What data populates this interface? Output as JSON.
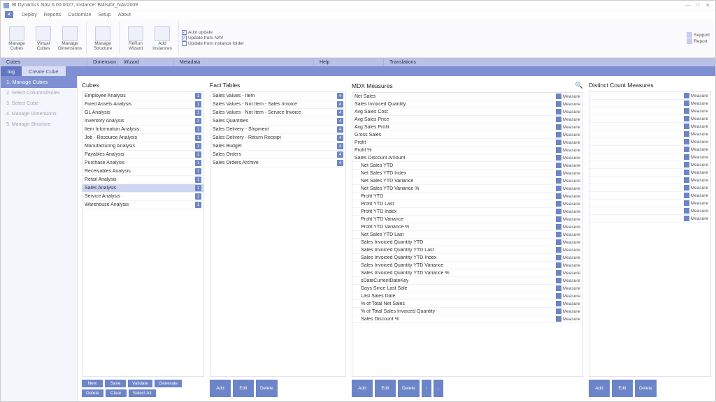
{
  "window": {
    "title": "BI Dynamics NAV 6.00.0027, Instance: BI4NAV_NAV2009"
  },
  "menu": {
    "items": [
      "Deploy",
      "Reports",
      "Customize",
      "Setup",
      "About"
    ]
  },
  "ribbon": {
    "groups": [
      {
        "label": "Cubes",
        "buttons": [
          {
            "key": "manage-cubes",
            "label": "Manage Cubes"
          },
          {
            "key": "virtual-cubes",
            "label": "Virtual Cubes"
          },
          {
            "key": "manage-dimensions",
            "label": "Manage Dimensions"
          }
        ]
      },
      {
        "label": "Dimension",
        "buttons": [
          {
            "key": "manage-structure",
            "label": "Manage Structure"
          }
        ]
      },
      {
        "label": "Wizard",
        "buttons": [
          {
            "key": "rerun-wizard",
            "label": "ReRun Wizard"
          },
          {
            "key": "add-instances",
            "label": "Add Instances"
          }
        ]
      }
    ],
    "checks": [
      {
        "key": "auto-update",
        "label": "Auto update",
        "checked": true
      },
      {
        "key": "update-from-nav",
        "label": "Update from NAV",
        "checked": true
      },
      {
        "key": "update-from-instance",
        "label": "Update from instance folder",
        "checked": false
      }
    ],
    "group_footer_labels": [
      "Cubes",
      "Dimension",
      "Wizard",
      "",
      "Metadata",
      "Help",
      "Translations"
    ],
    "right": [
      {
        "label": "Support"
      },
      {
        "label": "Report"
      }
    ]
  },
  "crumbs": {
    "log": "log",
    "create": "Create Cube"
  },
  "sidebar": {
    "items": [
      {
        "label": "1. Manage Cubes",
        "active": true
      },
      {
        "label": "2. Select Columns/Roles",
        "active": false
      },
      {
        "label": "3. Select Cube",
        "active": false
      },
      {
        "label": "4. Manage Dimensions",
        "active": false
      },
      {
        "label": "5. Manage Structure",
        "active": false
      }
    ]
  },
  "panels": {
    "cubes": {
      "title": "Cubes",
      "items": [
        {
          "label": "Employee Analysis",
          "badge": "1"
        },
        {
          "label": "Fixed Assets Analysis",
          "badge": "1"
        },
        {
          "label": "GL Analysis",
          "badge": "1"
        },
        {
          "label": "Inventory Analysis",
          "badge": "2"
        },
        {
          "label": "Item Information Analysis",
          "badge": "1"
        },
        {
          "label": "Job - Resource Analysis",
          "badge": "1"
        },
        {
          "label": "Manufacturing Analysis",
          "badge": "1"
        },
        {
          "label": "Payables Analysis",
          "badge": "1"
        },
        {
          "label": "Purchase Analysis",
          "badge": "1"
        },
        {
          "label": "Receivables Analysis",
          "badge": "1"
        },
        {
          "label": "Retail Analysis",
          "badge": "1"
        },
        {
          "label": "Sales Analysis",
          "badge": "1",
          "selected": true
        },
        {
          "label": "Service Analysis",
          "badge": "1"
        },
        {
          "label": "Warehouse Analysis",
          "badge": "1"
        }
      ]
    },
    "fact": {
      "title": "Fact Tables",
      "items": [
        {
          "label": "Sales Values - Item",
          "badge": "4"
        },
        {
          "label": "Sales Values - Not Item - Sales Invoice",
          "badge": "4"
        },
        {
          "label": "Sales Values - Not Item - Service Invoice",
          "badge": "4"
        },
        {
          "label": "Sales Quantities",
          "badge": "4"
        },
        {
          "label": "Sales Delivery - Shipment",
          "badge": "4"
        },
        {
          "label": "Sales Delivery - Return Receipt",
          "badge": "4"
        },
        {
          "label": "Sales Budget",
          "badge": "4"
        },
        {
          "label": "Sales Orders",
          "badge": "4"
        },
        {
          "label": "Sales Orders Archive",
          "badge": "4"
        }
      ]
    },
    "mdx": {
      "title": "MDX Measures",
      "items": [
        {
          "label": "Net Sales",
          "tag": "Measure"
        },
        {
          "label": "Sales Invoiced Quantity",
          "tag": "Measure"
        },
        {
          "label": "Avg Sales Cost",
          "tag": "Measure"
        },
        {
          "label": "Avg Sales Price",
          "tag": "Measure"
        },
        {
          "label": "Avg Sales Profit",
          "tag": "Measure"
        },
        {
          "label": "Gross Sales",
          "tag": "Measure"
        },
        {
          "label": "Profit",
          "tag": "Measure"
        },
        {
          "label": "Profit %",
          "tag": "Measure"
        },
        {
          "label": "Sales Discount Amount",
          "tag": "Measure"
        },
        {
          "label": "Net Sales YTD",
          "tag": "Measure",
          "child": true
        },
        {
          "label": "Net Sales YTD Index",
          "tag": "Measure",
          "child": true
        },
        {
          "label": "Net Sales YTD Variance",
          "tag": "Measure",
          "child": true
        },
        {
          "label": "Net Sales YTD Variance %",
          "tag": "Measure",
          "child": true
        },
        {
          "label": "Profit YTD",
          "tag": "Measure",
          "child": true
        },
        {
          "label": "Profit YTD Last",
          "tag": "Measure",
          "child": true
        },
        {
          "label": "Profit YTD Index",
          "tag": "Measure",
          "child": true
        },
        {
          "label": "Profit YTD Variance",
          "tag": "Measure",
          "child": true
        },
        {
          "label": "Profit YTD Variance %",
          "tag": "Measure",
          "child": true
        },
        {
          "label": "Net Sales YTD Last",
          "tag": "Measure",
          "child": true
        },
        {
          "label": "Sales Invoiced Quantity YTD",
          "tag": "Measure",
          "child": true
        },
        {
          "label": "Sales Invoiced Quantity YTD Last",
          "tag": "Measure",
          "child": true
        },
        {
          "label": "Sales Invoiced Quantity YTD Index",
          "tag": "Measure",
          "child": true
        },
        {
          "label": "Sales Invoiced Quantity YTD Variance",
          "tag": "Measure",
          "child": true
        },
        {
          "label": "Sales Invoiced Quantity YTD Variance %",
          "tag": "Measure",
          "child": true
        },
        {
          "label": "sDateCurrentDateKey",
          "tag": "Measure",
          "child": true
        },
        {
          "label": "Days Since Last Sale",
          "tag": "Measure",
          "child": true
        },
        {
          "label": "Last Sales Date",
          "tag": "Measure",
          "child": true
        },
        {
          "label": "% of Total Net Sales",
          "tag": "Measure",
          "child": true
        },
        {
          "label": "% of Total Sales Invoiced Quantity",
          "tag": "Measure",
          "child": true
        },
        {
          "label": "Sales Discount %",
          "tag": "Measure",
          "child": true
        }
      ]
    },
    "dcm": {
      "title": "Distinct Count Measures",
      "items": [
        {
          "label": "",
          "tag": "Measure"
        },
        {
          "label": "",
          "tag": "Measure"
        },
        {
          "label": "",
          "tag": "Measure"
        },
        {
          "label": "",
          "tag": "Measure"
        },
        {
          "label": "",
          "tag": "Measure"
        },
        {
          "label": "",
          "tag": "Measure"
        },
        {
          "label": "",
          "tag": "Measure"
        },
        {
          "label": "",
          "tag": "Measure"
        },
        {
          "label": "",
          "tag": "Measure"
        },
        {
          "label": "",
          "tag": "Measure"
        },
        {
          "label": "",
          "tag": "Measure"
        },
        {
          "label": "",
          "tag": "Measure"
        },
        {
          "label": "",
          "tag": "Measure"
        },
        {
          "label": "",
          "tag": "Measure"
        },
        {
          "label": "",
          "tag": "Measure"
        },
        {
          "label": "",
          "tag": "Measure"
        },
        {
          "label": "",
          "tag": "Measure"
        }
      ]
    }
  },
  "buttons": {
    "cubes": [
      "New",
      "Save",
      "Validate",
      "Generate",
      "Delete",
      "Clear",
      "Select All"
    ],
    "fact": [
      "Add",
      "Edit",
      "Delete"
    ],
    "mdx": [
      "Add",
      "Edit",
      "Delete",
      "↑",
      "↓"
    ],
    "dcm": [
      "Add",
      "Edit",
      "Delete"
    ]
  }
}
